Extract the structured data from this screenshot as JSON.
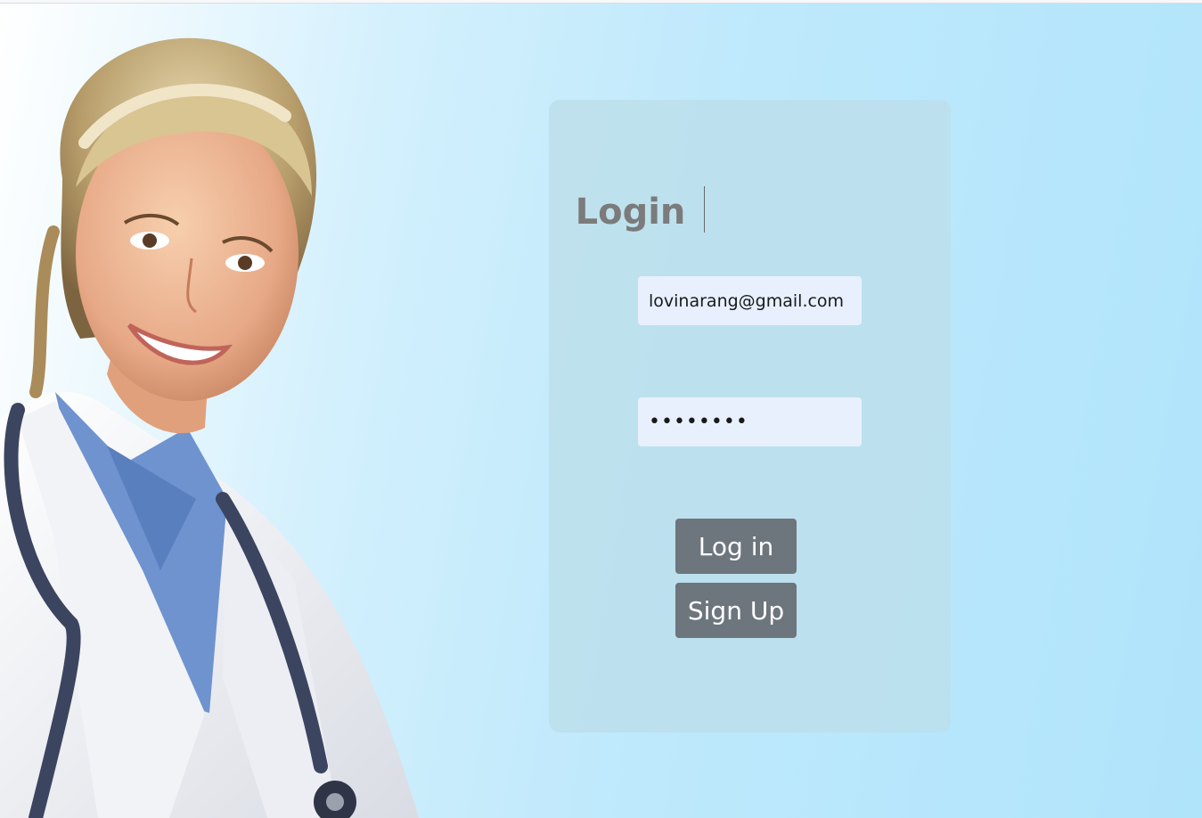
{
  "login": {
    "title": "Login",
    "email_value": "lovinarang@gmail.com",
    "password_value": "12345678",
    "login_button": "Log in",
    "signup_button": "Sign Up"
  },
  "colors": {
    "background": "#b0e4fb",
    "card": "#bddee9",
    "input_bg": "#e8f0fe",
    "button": "#6d757d",
    "title": "#7b7b7b"
  }
}
